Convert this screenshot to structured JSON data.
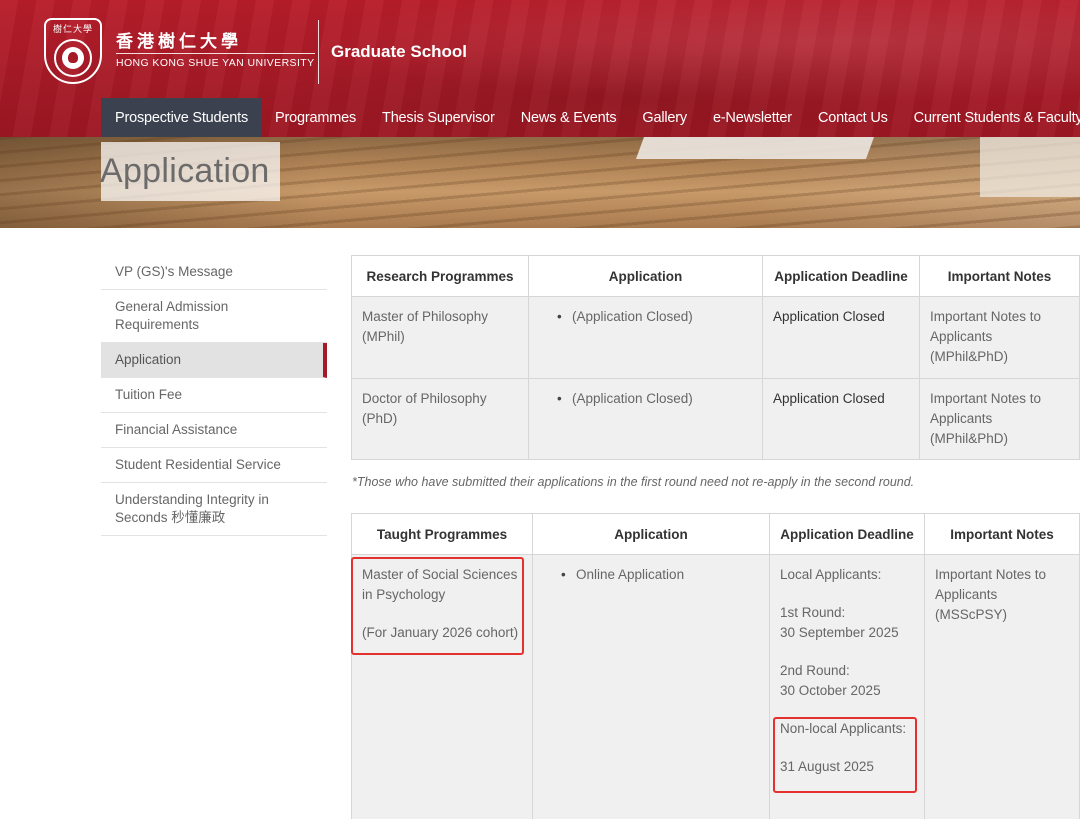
{
  "header": {
    "seal_text": "樹仁大學",
    "university_zh": "香港樹仁大學",
    "university_en": "HONG KONG SHUE YAN UNIVERSITY",
    "school": "Graduate School"
  },
  "nav": {
    "items": [
      {
        "label": "Prospective Students",
        "active": true
      },
      {
        "label": "Programmes"
      },
      {
        "label": "Thesis Supervisor"
      },
      {
        "label": "News & Events"
      },
      {
        "label": "Gallery"
      },
      {
        "label": "e-Newsletter"
      },
      {
        "label": "Contact Us"
      },
      {
        "label": "Current Students & Faculty only"
      }
    ]
  },
  "banner": {
    "title": "Application"
  },
  "sidebar": {
    "items": [
      {
        "label": "VP (GS)'s Message"
      },
      {
        "label": "General Admission Requirements"
      },
      {
        "label": "Application",
        "active": true
      },
      {
        "label": "Tuition Fee"
      },
      {
        "label": "Financial Assistance"
      },
      {
        "label": "Student Residential Service"
      },
      {
        "label": "Understanding Integrity in Seconds 秒懂廉政"
      }
    ]
  },
  "research_table": {
    "headers": [
      "Research Programmes",
      "Application",
      "Application Deadline",
      "Important Notes"
    ],
    "rows": [
      {
        "programme": "Master of Philosophy (MPhil)",
        "application": "(Application Closed)",
        "deadline": "Application Closed",
        "notes": "Important Notes to Applicants (MPhil&PhD)"
      },
      {
        "programme": "Doctor of Philosophy (PhD)",
        "application": "(Application Closed)",
        "deadline": "Application Closed",
        "notes": "Important Notes to Applicants (MPhil&PhD)"
      }
    ]
  },
  "note": "*Those who have submitted their applications in the first round need not re-apply in the second round.",
  "taught_table": {
    "headers": [
      "Taught Programmes",
      "Application",
      "Application Deadline",
      "Important Notes"
    ],
    "rows": [
      {
        "programme": "Master of Social Sciences in Psychology",
        "cohort": "(For January 2026 cohort)",
        "application": "Online Application",
        "deadline_local_label": "Local Applicants:",
        "round1_label": "1st Round:",
        "round1_date": "30 September 2025",
        "round2_label": "2nd Round:",
        "round2_date": "30 October 2025",
        "nonlocal_label": "Non-local Applicants:",
        "nonlocal_date": "31 August 2025",
        "notes": "Important Notes to Applicants (MSScPSY)"
      }
    ]
  },
  "colors": {
    "brand_red": "#a51a26",
    "nav_active": "#3c4150",
    "highlight": "#e5312e"
  }
}
